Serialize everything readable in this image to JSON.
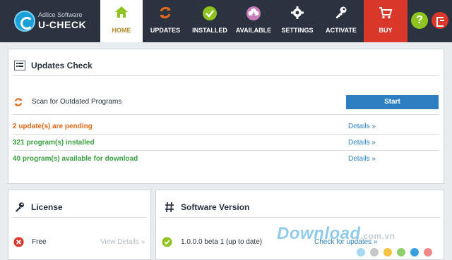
{
  "brand": {
    "line1": "Adlice Software",
    "line2": "U-CHECK"
  },
  "nav": {
    "home": "HOME",
    "updates": "UPDATES",
    "installed": "INSTALLED",
    "available": "AVAILABLE",
    "settings": "SETTINGS",
    "activate": "ACTIVATE",
    "buy": "BUY"
  },
  "header_buttons": {
    "help": "?"
  },
  "updates_check": {
    "title": "Updates Check",
    "scan_label": "Scan for Outdated Programs",
    "start_label": "Start",
    "pending": "2 update(s) are pending",
    "installed": "321 program(s) installed",
    "available": "40 program(s) available for download",
    "details_label": "Details »"
  },
  "license": {
    "title": "License",
    "value": "Free",
    "link": "View Details »"
  },
  "software_version": {
    "title": "Software Version",
    "value": "1.0.0.0 beta 1 (up to date)",
    "link": "Check for updates »"
  },
  "watermark": {
    "text": "Download",
    "suffix": ".com.vn"
  },
  "colors": {
    "nav_bg": "#2b3340",
    "buy": "#d9372a",
    "start_button": "#2d7fc1",
    "pending": "#e06a1c",
    "ok": "#3ca042",
    "help": "#8fc31f",
    "watermark_dots": [
      "#a7d8f2",
      "#c7c7c7",
      "#f5c242",
      "#8fd06a",
      "#3aa0dc",
      "#f08a8a"
    ]
  }
}
